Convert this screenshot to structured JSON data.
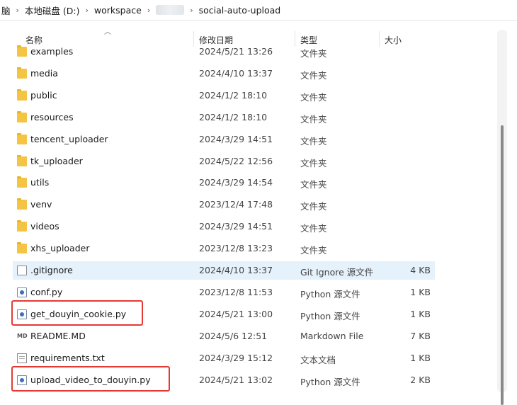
{
  "breadcrumb": {
    "items": [
      "脑",
      "本地磁盘 (D:)",
      "workspace",
      "social-auto-upload"
    ],
    "separator": "›"
  },
  "columns": {
    "name": "名称",
    "date": "修改日期",
    "type": "类型",
    "size": "大小"
  },
  "files": [
    {
      "name": "examples",
      "date": "2024/5/21 13:26",
      "type": "文件夹",
      "size": "",
      "icon": "folder-icon"
    },
    {
      "name": "media",
      "date": "2024/4/10 13:37",
      "type": "文件夹",
      "size": "",
      "icon": "folder-icon"
    },
    {
      "name": "public",
      "date": "2024/1/2 18:10",
      "type": "文件夹",
      "size": "",
      "icon": "folder-icon"
    },
    {
      "name": "resources",
      "date": "2024/1/2 18:10",
      "type": "文件夹",
      "size": "",
      "icon": "folder-icon"
    },
    {
      "name": "tencent_uploader",
      "date": "2024/3/29 14:51",
      "type": "文件夹",
      "size": "",
      "icon": "folder-icon"
    },
    {
      "name": "tk_uploader",
      "date": "2024/5/22 12:56",
      "type": "文件夹",
      "size": "",
      "icon": "folder-icon"
    },
    {
      "name": "utils",
      "date": "2024/3/29 14:54",
      "type": "文件夹",
      "size": "",
      "icon": "folder-icon"
    },
    {
      "name": "venv",
      "date": "2023/12/4 17:48",
      "type": "文件夹",
      "size": "",
      "icon": "folder-icon"
    },
    {
      "name": "videos",
      "date": "2024/3/29 14:51",
      "type": "文件夹",
      "size": "",
      "icon": "folder-icon"
    },
    {
      "name": "xhs_uploader",
      "date": "2023/12/8 13:23",
      "type": "文件夹",
      "size": "",
      "icon": "folder-icon"
    },
    {
      "name": ".gitignore",
      "date": "2024/4/10 13:37",
      "type": "Git Ignore 源文件",
      "size": "4 KB",
      "icon": "file-icon",
      "selected": true
    },
    {
      "name": "conf.py",
      "date": "2023/12/8 11:53",
      "type": "Python 源文件",
      "size": "1 KB",
      "icon": "python-file-icon"
    },
    {
      "name": "get_douyin_cookie.py",
      "date": "2024/5/21 13:00",
      "type": "Python 源文件",
      "size": "1 KB",
      "icon": "python-file-icon",
      "highlighted": true
    },
    {
      "name": "README.MD",
      "date": "2024/5/6 12:51",
      "type": "Markdown File",
      "size": "7 KB",
      "icon": "markdown-file-icon"
    },
    {
      "name": "requirements.txt",
      "date": "2024/3/29 15:12",
      "type": "文本文档",
      "size": "1 KB",
      "icon": "text-file-icon"
    },
    {
      "name": "upload_video_to_douyin.py",
      "date": "2024/5/21 13:02",
      "type": "Python 源文件",
      "size": "2 KB",
      "icon": "python-file-icon",
      "highlighted": true
    }
  ],
  "colors": {
    "selection": "#e5f1fb",
    "highlight_border": "#e53935",
    "folder": "#f4c542"
  }
}
